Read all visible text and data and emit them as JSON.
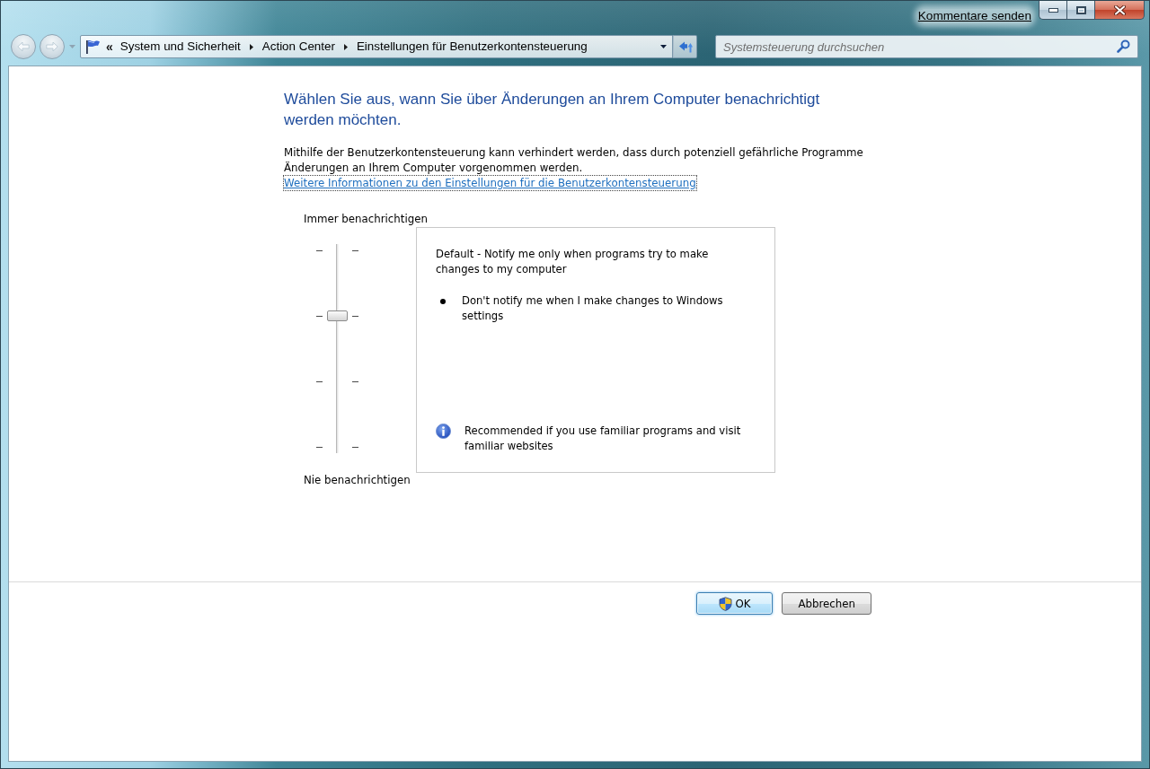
{
  "window": {
    "feedback_link": "Kommentare senden"
  },
  "navigation": {
    "back_button": {
      "disabled": true
    },
    "forward_button": {
      "disabled": true
    },
    "address": {
      "overflow": "«",
      "breadcrumbs": [
        {
          "label": "System und Sicherheit"
        },
        {
          "label": "Action Center"
        },
        {
          "label": "Einstellungen für Benutzerkontensteuerung"
        }
      ]
    },
    "search": {
      "placeholder": "Systemsteuerung durchsuchen"
    }
  },
  "page": {
    "heading": "Wählen Sie aus, wann Sie über Änderungen an Ihrem Computer benachrichtigt werden möchten.",
    "description": "Mithilfe der Benutzerkontensteuerung kann verhindert werden, dass durch potenziell gefährliche Programme Änderungen an Ihrem Computer vorgenommen werden.",
    "link": "Weitere Informationen zu den Einstellungen für die Benutzerkontensteuerung"
  },
  "slider": {
    "top_label": "Immer benachrichtigen",
    "bottom_label": "Nie benachrichtigen",
    "level": 0.6667
  },
  "info_box": {
    "title": "Default - Notify me only when programs try to make changes to my computer",
    "bullets": [
      "Don't notify me when I make changes to Windows settings"
    ],
    "note": "Recommended if you use familiar programs and visit familiar websites"
  },
  "buttons": [
    {
      "label": "OK",
      "kind": "elevated",
      "focused": true
    },
    {
      "label": "Abbrechen",
      "kind": "plain",
      "focused": false
    }
  ]
}
